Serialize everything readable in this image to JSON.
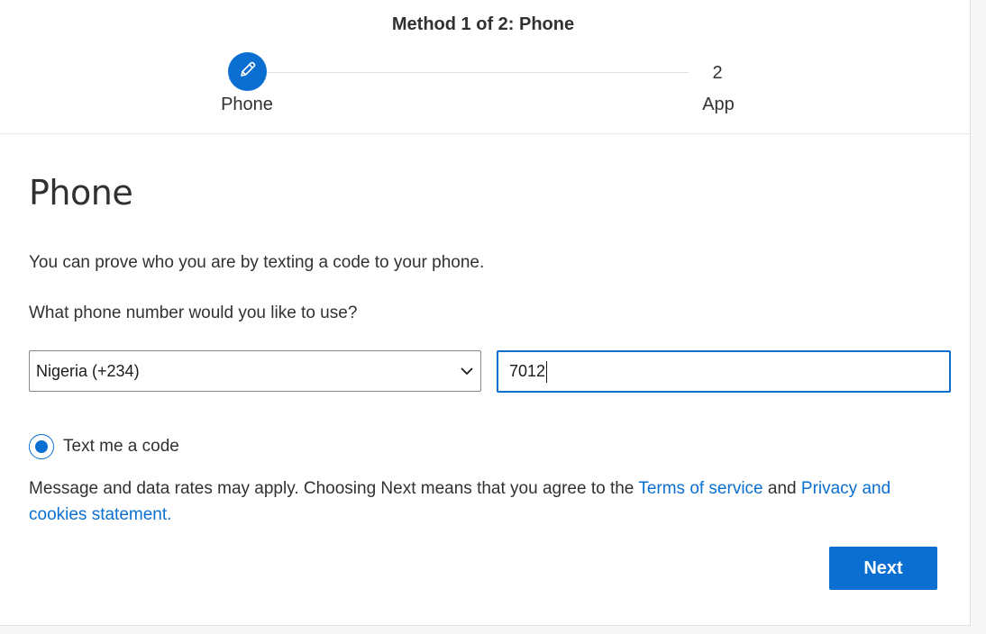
{
  "stepper": {
    "title": "Method 1 of 2: Phone",
    "steps": [
      {
        "label": "Phone",
        "icon": "pencil-icon",
        "active": true
      },
      {
        "number": "2",
        "label": "App",
        "active": false
      }
    ]
  },
  "main": {
    "heading": "Phone",
    "description": "You can prove who you are by texting a code to your phone.",
    "question": "What phone number would you like to use?",
    "country_select": {
      "value": "Nigeria (+234)",
      "icon": "chevron-down-icon"
    },
    "phone_input": {
      "value": "7012"
    },
    "radio_option": {
      "label": "Text me a code",
      "selected": true
    },
    "legal": {
      "text_before": "Message and data rates may apply. Choosing Next means that you agree to the ",
      "terms_link": "Terms of service",
      "text_middle": " and ",
      "privacy_link": "Privacy and cookies statement."
    },
    "next_button": "Next"
  },
  "colors": {
    "accent": "#0b6fd1",
    "text": "#323130",
    "border": "#8a8886"
  }
}
